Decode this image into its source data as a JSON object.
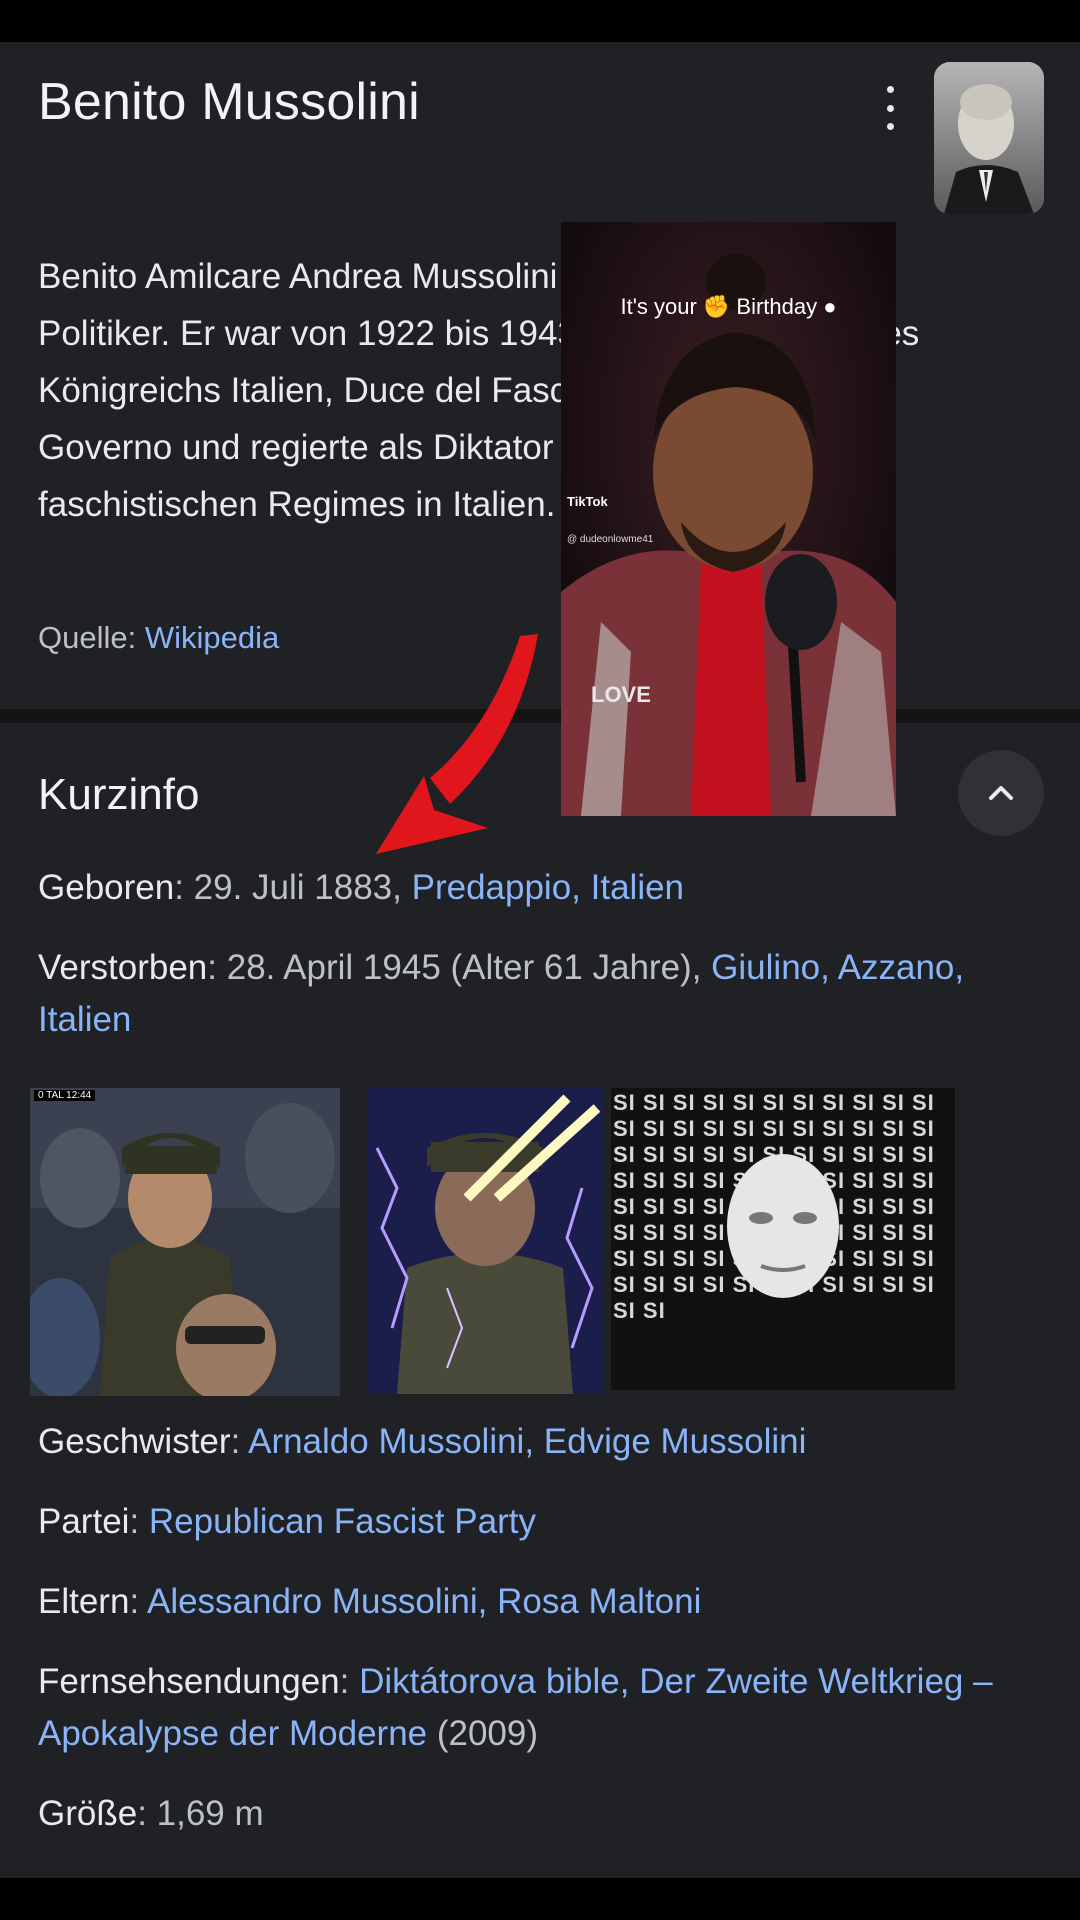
{
  "title": "Benito Mussolini",
  "description": "Benito Amilcare Andrea Mussolini war ein italienischer Politiker. Er war von 1922 bis 1943 Ministerpräsident des Königreichs Italien, Duce del Fascismo und Capo del Governo und regierte als Diktator an der Spitze des faschistischen Regimes in Italien.",
  "source": {
    "label": "Quelle: ",
    "link": "Wikipedia"
  },
  "section": {
    "title": "Kurzinfo"
  },
  "facts": {
    "born": {
      "key": "Geboren",
      "value": ": 29. Juli 1883, ",
      "link": "Predappio, Italien"
    },
    "died": {
      "key": "Verstorben",
      "value": ": 28. April 1945 (Alter 61 Jahre), ",
      "link": "Giulino, Azzano, Italien"
    },
    "siblings": {
      "key": "Geschwister",
      "value": ": ",
      "link": "Arnaldo Mussolini, Edvige Mussolini"
    },
    "party": {
      "key": "Partei",
      "value": ": ",
      "link": "Republican Fascist Party"
    },
    "parents": {
      "key": "Eltern",
      "value": ": ",
      "link": "Alessandro Mussolini, Rosa Maltoni"
    },
    "tv": {
      "key": "Fernsehsendungen",
      "value": ": ",
      "link": "Diktátorova bible, Der Zweite Weltkrieg – Apokalypse der Moderne",
      "suffix": " (2009)"
    },
    "height": {
      "key": "Größe",
      "value": ": 1,69 m"
    }
  },
  "tiktok": {
    "caption": "It's your ✊ Birthday ●",
    "logo": "TikTok",
    "handle": "@ dudeonlowme41"
  },
  "collage": {
    "scoreboard": "0 TAL 12:44",
    "si_text": "SI SI SI SI SI SI SI SI SI SI SI SI SI SI SI SI SI SI SI SI SI SI SI SI SI SI SI SI SI SI SI SI SI SI SI SI SI SI SI SI SI SI SI SI SI SI SI SI SI SI SI SI SI SI SI SI SI SI SI SI SI SI SI SI SI SI SI SI SI SI SI SI SI SI SI SI SI SI SI SI SI SI SI SI SI SI SI SI SI SI"
  },
  "colors": {
    "background": "#202124",
    "link": "#8ab4f8",
    "text": "#e8eaed",
    "muted": "#bdc1c6",
    "arrow": "#e0161c"
  }
}
